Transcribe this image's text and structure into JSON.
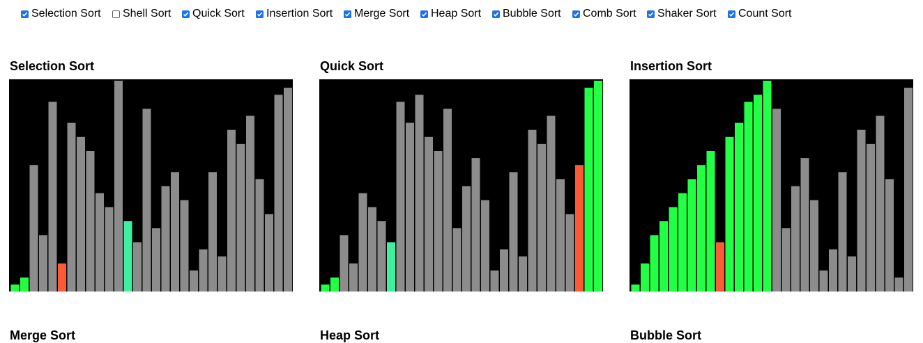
{
  "checkboxes": [
    {
      "label": "Selection Sort",
      "checked": true
    },
    {
      "label": "Shell Sort",
      "checked": false
    },
    {
      "label": "Quick Sort",
      "checked": true
    },
    {
      "label": "Insertion Sort",
      "checked": true
    },
    {
      "label": "Merge Sort",
      "checked": true
    },
    {
      "label": "Heap Sort",
      "checked": true
    },
    {
      "label": "Bubble Sort",
      "checked": true
    },
    {
      "label": "Comb Sort",
      "checked": true
    },
    {
      "label": "Shaker Sort",
      "checked": true
    },
    {
      "label": "Count Sort",
      "checked": true
    }
  ],
  "colors": {
    "default": "#8c8c8c",
    "sorted": "#22ff44",
    "compare": "#ff5a36",
    "pivot": "#3fefa0",
    "background": "#000000",
    "accent": "#1a73e8"
  },
  "panels": [
    {
      "title": "Selection Sort",
      "values": [
        1,
        2,
        18,
        8,
        27,
        4,
        24,
        22,
        20,
        14,
        12,
        30,
        10,
        7,
        26,
        9,
        15,
        17,
        13,
        3,
        6,
        17,
        5,
        23,
        21,
        25,
        16,
        11,
        28,
        29
      ],
      "states": [
        "s",
        "s",
        "d",
        "d",
        "d",
        "c",
        "d",
        "d",
        "d",
        "d",
        "d",
        "d",
        "p",
        "d",
        "d",
        "d",
        "d",
        "d",
        "d",
        "d",
        "d",
        "d",
        "d",
        "d",
        "d",
        "d",
        "d",
        "d",
        "d",
        "d"
      ]
    },
    {
      "title": "Quick Sort",
      "values": [
        1,
        2,
        8,
        4,
        14,
        12,
        10,
        7,
        27,
        24,
        28,
        22,
        20,
        26,
        9,
        15,
        19,
        13,
        3,
        6,
        17,
        5,
        23,
        21,
        25,
        16,
        11,
        18,
        29,
        30
      ],
      "states": [
        "s",
        "s",
        "d",
        "d",
        "d",
        "d",
        "d",
        "p",
        "d",
        "d",
        "d",
        "d",
        "d",
        "d",
        "d",
        "d",
        "d",
        "d",
        "d",
        "d",
        "d",
        "d",
        "d",
        "d",
        "d",
        "d",
        "d",
        "c",
        "s",
        "s"
      ]
    },
    {
      "title": "Insertion Sort",
      "values": [
        1,
        4,
        8,
        10,
        12,
        14,
        16,
        18,
        20,
        7,
        22,
        24,
        27,
        28,
        30,
        26,
        9,
        15,
        19,
        13,
        3,
        6,
        17,
        5,
        23,
        21,
        25,
        16,
        2,
        29
      ],
      "states": [
        "s",
        "s",
        "s",
        "s",
        "s",
        "s",
        "s",
        "s",
        "s",
        "c",
        "s",
        "s",
        "s",
        "s",
        "s",
        "d",
        "d",
        "d",
        "d",
        "d",
        "d",
        "d",
        "d",
        "d",
        "d",
        "d",
        "d",
        "d",
        "d",
        "d"
      ]
    },
    {
      "title": "Merge Sort",
      "values": [],
      "states": []
    },
    {
      "title": "Heap Sort",
      "values": [],
      "states": []
    },
    {
      "title": "Bubble Sort",
      "values": [],
      "states": []
    }
  ]
}
